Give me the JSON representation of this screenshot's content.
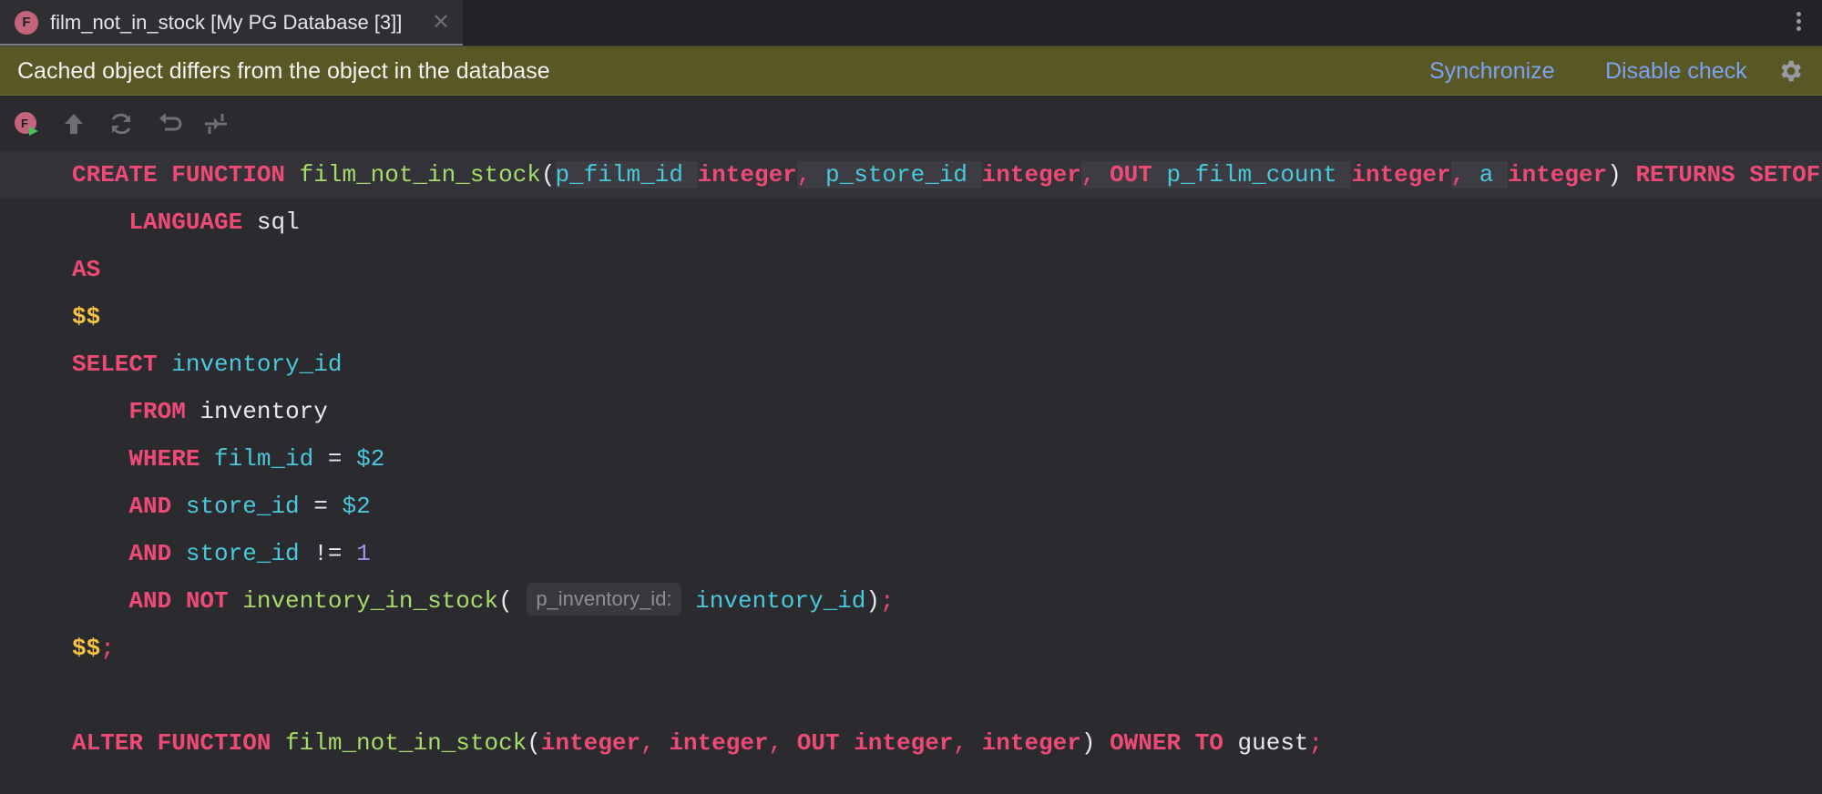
{
  "tab": {
    "icon_letter": "F",
    "title": "film_not_in_stock [My PG Database [3]]",
    "close": "✕"
  },
  "banner": {
    "message": "Cached object differs from the object in the database",
    "synchronize": "Synchronize",
    "disable_check": "Disable check"
  },
  "toolbar": {
    "icons": [
      "execute-function-icon",
      "upload-icon",
      "refresh-icon",
      "undo-icon",
      "compare-icon"
    ]
  },
  "code": {
    "l1": {
      "create": "CREATE FUNCTION",
      "name": "film_not_in_stock",
      "paren_open": "(",
      "p1": "p_film_id",
      "t1": "integer",
      "c1": ",",
      "p2": "p_store_id",
      "t2": "integer",
      "c2": ",",
      "out": "OUT",
      "p3": "p_film_count",
      "t3": "integer",
      "c3": ",",
      "p4": "a",
      "t4": "integer",
      "paren_close": ")",
      "returns": "RETURNS SETOF"
    },
    "l2": {
      "kw": "LANGUAGE",
      "val": "sql"
    },
    "l3": {
      "kw": "AS"
    },
    "l4": {
      "dollar": "$$"
    },
    "l5": {
      "kw": "SELECT",
      "col": "inventory_id"
    },
    "l6": {
      "kw": "FROM",
      "table": "inventory"
    },
    "l7": {
      "kw": "WHERE",
      "col": "film_id",
      "op": "=",
      "param": "$2"
    },
    "l8": {
      "kw": "AND",
      "col": "store_id",
      "op": "=",
      "param": "$2"
    },
    "l9": {
      "kw": "AND",
      "col": "store_id",
      "op": "!=",
      "num": "1"
    },
    "l10": {
      "kw": "AND NOT",
      "fn": "inventory_in_stock",
      "paren_open": "(",
      "hint": "p_inventory_id:",
      "arg": "inventory_id",
      "paren_close": ")",
      "semi": ";"
    },
    "l11": {
      "dollar": "$$",
      "semi": ";"
    },
    "l13": {
      "alter": "ALTER FUNCTION",
      "name": "film_not_in_stock",
      "paren_open": "(",
      "t1": "integer",
      "c1": ",",
      "t2": "integer",
      "c2": ",",
      "out": "OUT",
      "t3": "integer",
      "c3": ",",
      "t4": "integer",
      "paren_close": ")",
      "owner": "OWNER TO",
      "user": "guest",
      "semi": ";"
    }
  },
  "colors": {
    "keyword": "#ee4a76",
    "function": "#a6dd6a",
    "identifier": "#4ac9dc",
    "dollar_quote": "#f5c244",
    "number": "#a98ef0",
    "banner_bg": "#595726",
    "link": "#7da2ef"
  }
}
